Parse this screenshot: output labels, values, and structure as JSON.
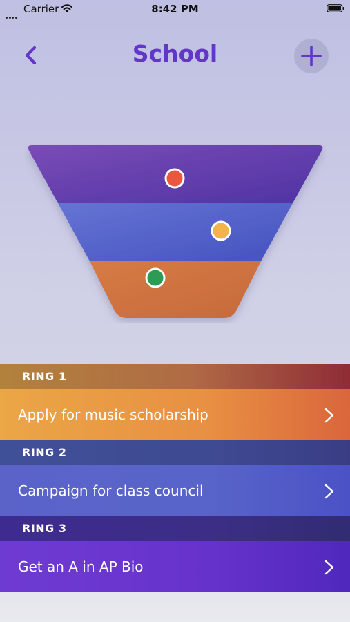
{
  "status_bar": {
    "carrier": "Carrier",
    "time": "8:42 PM"
  },
  "nav": {
    "title": "School",
    "back_icon": "chevron-left-icon",
    "add_icon": "plus-icon"
  },
  "colors": {
    "accent": "#6236c9",
    "ring1": "#eba646",
    "ring2": "#5b63c9",
    "ring3": "#6e3bd2",
    "dot_red": "#e8573e",
    "dot_yellow": "#f0b44a",
    "dot_green": "#2f9a54"
  },
  "rings": [
    {
      "header": "RING 1",
      "goal": "Apply for music scholarship"
    },
    {
      "header": "RING 2",
      "goal": "Campaign for class council"
    },
    {
      "header": "RING 3",
      "goal": "Get an A in AP Bio"
    }
  ]
}
